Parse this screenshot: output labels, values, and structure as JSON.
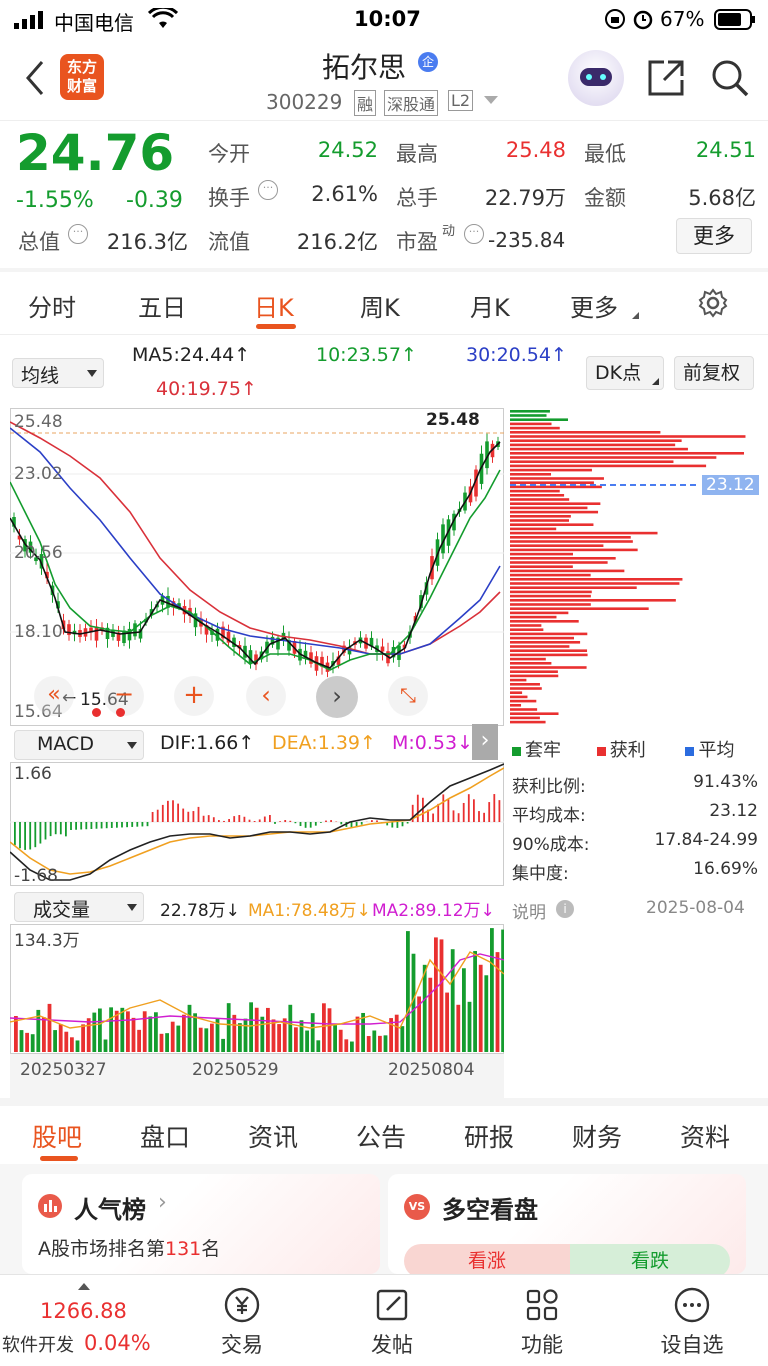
{
  "status_bar": {
    "carrier": "中国电信",
    "time": "10:07",
    "battery": "67%"
  },
  "header": {
    "logo_line1": "东方",
    "logo_line2": "财富",
    "stock_name": "拓尔思",
    "badge_enterprise": "企",
    "stock_code": "300229",
    "tag_rong": "融",
    "tag_sgt": "深股通",
    "tag_l2": "L2"
  },
  "quote": {
    "price": "24.76",
    "change_pct": "-1.55%",
    "change": "-0.39",
    "open_label": "今开",
    "open": "24.52",
    "high_label": "最高",
    "high": "25.48",
    "low_label": "最低",
    "low": "24.51",
    "turnover_label": "换手",
    "turnover": "2.61%",
    "volume_label": "总手",
    "volume": "22.79万",
    "amount_label": "金额",
    "amount": "5.68亿",
    "mktcap_label": "总值",
    "mktcap": "216.3亿",
    "float_label": "流值",
    "float_cap": "216.2亿",
    "pe_label": "市盈",
    "pe_sup": "动",
    "pe": "-235.84",
    "more_label": "更多"
  },
  "period_tabs": {
    "items": [
      "分时",
      "五日",
      "日K",
      "周K",
      "月K",
      "更多"
    ],
    "active_index": 2
  },
  "ma_bar": {
    "selector": "均线",
    "ma5": "MA5:24.44↑",
    "ma10": "10:23.57↑",
    "ma30": "30:20.54↑",
    "ma40": "40:19.75↑",
    "dk_button": "DK点",
    "adjust_button": "前复权"
  },
  "kline": {
    "y_labels": [
      "25.48",
      "23.02",
      "20.56",
      "18.10",
      "15.64"
    ],
    "high_marker": "25.48",
    "low_marker": "15.64",
    "cost_line_label": "23.12"
  },
  "macd": {
    "selector": "MACD",
    "dif": "DIF:1.66↑",
    "dea": "DEA:1.39↑",
    "m": "M:0.53↓",
    "top": "1.66",
    "bottom": "-1.68"
  },
  "chip": {
    "legend_trapped": "套牢",
    "legend_profit": "获利",
    "legend_avg": "平均",
    "rows": [
      {
        "label": "获利比例:",
        "value": "91.43%"
      },
      {
        "label": "平均成本:",
        "value": "23.12"
      },
      {
        "label": "90%成本:",
        "value": "17.84-24.99"
      },
      {
        "label": "集中度:",
        "value": "16.69%"
      }
    ],
    "explain_label": "说明",
    "date": "2025-08-04"
  },
  "volume": {
    "selector": "成交量",
    "value": "22.78万↓",
    "ma1": "MA1:78.48万↓",
    "ma2": "MA2:89.12万↓",
    "top": "134.3万",
    "dates": [
      "20250327",
      "20250529",
      "20250804"
    ]
  },
  "bottom_tabs": {
    "items": [
      "股吧",
      "盘口",
      "资讯",
      "公告",
      "研报",
      "财务",
      "资料"
    ],
    "active_index": 0
  },
  "cards": {
    "popular_title": "人气榜",
    "popular_rank_prefix": "A股市场排名第",
    "popular_rank": "131",
    "popular_rank_suffix": "名",
    "bullbear_title": "多空看盘",
    "bull_label": "看涨",
    "bear_label": "看跌"
  },
  "bottom_nav": {
    "index_value": "1266.88",
    "index_name": "软件开发",
    "index_change": "0.04%",
    "items": [
      "交易",
      "发帖",
      "功能",
      "设自选"
    ]
  },
  "colors": {
    "up": "#e93030",
    "down": "#149c2e",
    "accent": "#e9541f",
    "ma10": "#149c2e",
    "ma30": "#2b3fc6",
    "ma40": "#d9313a"
  }
}
